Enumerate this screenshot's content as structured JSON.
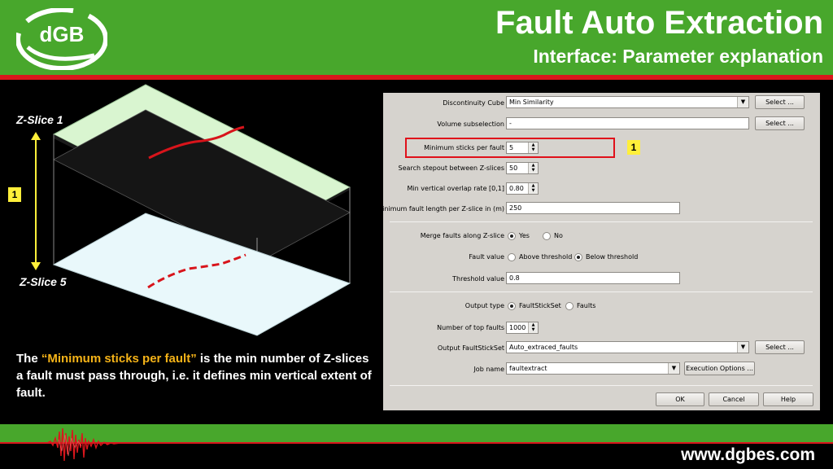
{
  "header": {
    "logo_text": "dGB",
    "title": "Fault Auto Extraction",
    "subtitle": "Interface: Parameter explanation"
  },
  "illustration": {
    "zslice_top_label": "Z-Slice 1",
    "zslice_bottom_label": "Z-Slice 5",
    "badge": "1"
  },
  "explanation": {
    "prefix": "The ",
    "highlight": "“Minimum sticks per fault”",
    "suffix": " is the min number of Z-slices a fault must pass through, i.e. it defines min vertical extent of fault."
  },
  "dialog": {
    "discontinuity_cube": {
      "label": "Discontinuity Cube",
      "value": "Min Similarity",
      "button": "Select ..."
    },
    "volume_subselection": {
      "label": "Volume subselection",
      "value": "-",
      "button": "Select ..."
    },
    "min_sticks": {
      "label": "Minimum sticks per fault",
      "value": "5",
      "badge": "1"
    },
    "search_stepout": {
      "label": "Search stepout between Z-slices",
      "value": "50"
    },
    "min_vertical_overlap": {
      "label": "Min vertical overlap rate [0,1]",
      "value": "0.80"
    },
    "min_fault_length": {
      "label": "Minimum fault length per Z-slice in (m)",
      "value": "250"
    },
    "merge_faults": {
      "label": "Merge faults along Z-slice",
      "opt_yes": "Yes",
      "opt_no": "No",
      "selected": "Yes"
    },
    "fault_value": {
      "label": "Fault value",
      "opt_above": "Above threshold",
      "opt_below": "Below threshold",
      "selected": "Below threshold"
    },
    "threshold_value": {
      "label": "Threshold value",
      "value": "0.8"
    },
    "output_type": {
      "label": "Output type",
      "opt_stickset": "FaultStickSet",
      "opt_faults": "Faults",
      "selected": "FaultStickSet"
    },
    "number_top_faults": {
      "label": "Number of top faults",
      "value": "1000"
    },
    "output_stickset": {
      "label": "Output FaultStickSet",
      "value": "Auto_extraced_faults",
      "button": "Select ..."
    },
    "job_name": {
      "label": "Job name",
      "value": "faultextract",
      "button": "Execution Options ..."
    },
    "ok": "OK",
    "cancel": "Cancel",
    "help": "Help"
  },
  "footer": {
    "website": "www.dgbes.com"
  },
  "colors": {
    "brand_green": "#48a72c",
    "brand_red": "#d9161c",
    "highlight_orange": "#f5b318",
    "badge_yellow": "#ffef3a"
  }
}
